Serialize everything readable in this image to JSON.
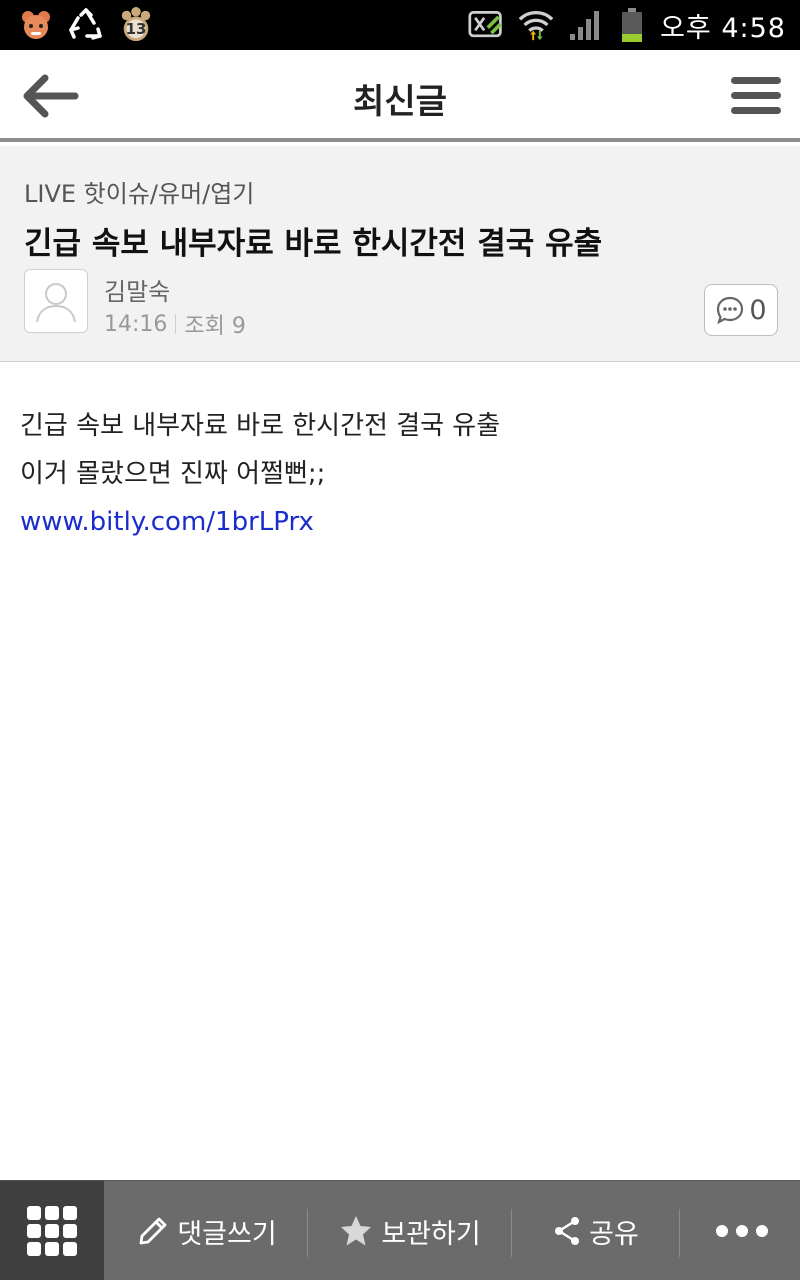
{
  "status_bar": {
    "notification_badge": "13",
    "time": "오후 4:58"
  },
  "header": {
    "title": "최신글",
    "back_icon": "arrow-left-icon",
    "menu_icon": "hamburger-menu-icon"
  },
  "post": {
    "category": "LIVE 핫이슈/유머/엽기",
    "title": "긴급 속보 내부자료 바로 한시간전 결국 유출",
    "author": "김말숙",
    "time": "14:16",
    "views": "조회 9",
    "comment_count": "0",
    "body_lines": [
      "긴급 속보 내부자료 바로 한시간전 결국 유출",
      "이거 몰랐으면 진짜 어쩔뻔;;"
    ],
    "link": "www.bitly.com/1brLPrx"
  },
  "bottom_bar": {
    "write_comment": "댓글쓰기",
    "save": "보관하기",
    "share": "공유"
  },
  "colors": {
    "link": "#1a2ccc",
    "bottom_bar": "#6b6b6b",
    "bottom_bar_active": "#3f3f3f",
    "post_head_bg": "#f2f2f2"
  }
}
